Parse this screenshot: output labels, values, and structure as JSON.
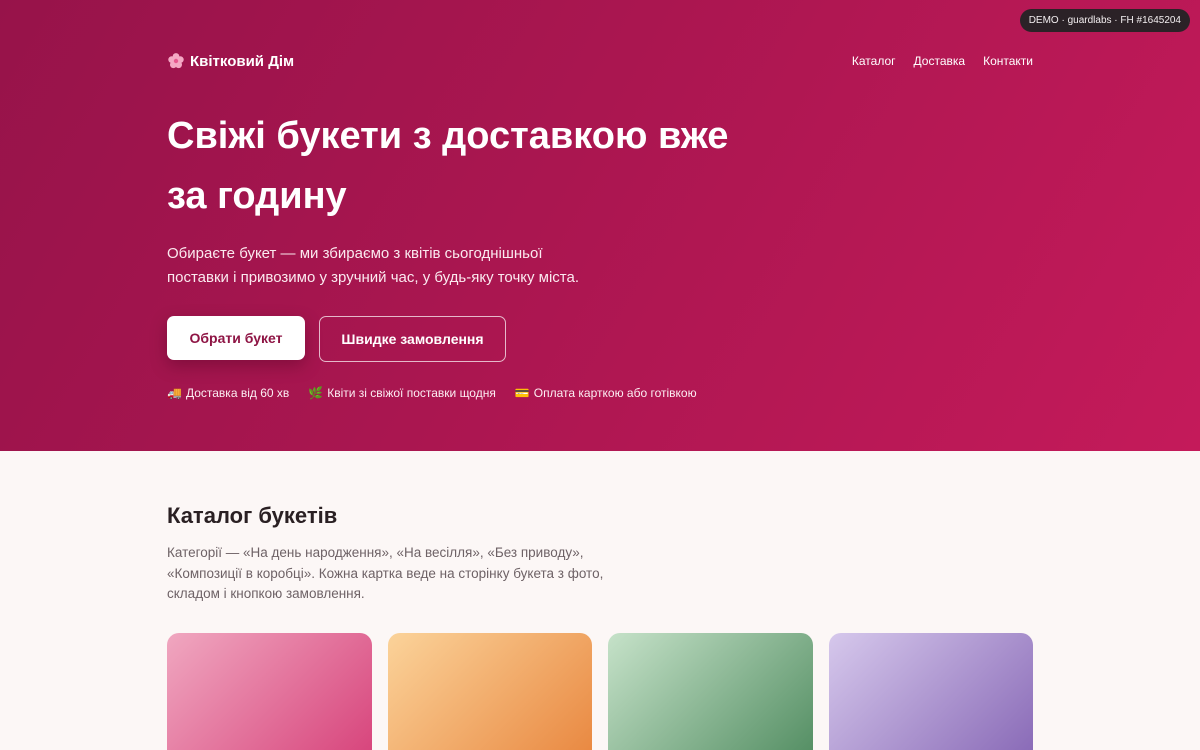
{
  "demo_badge": "DEMO · guardlabs · FH #1645204",
  "brand": {
    "name": "Квітковий Дім",
    "icon": "flower-icon"
  },
  "nav": [
    {
      "label": "Каталог"
    },
    {
      "label": "Доставка"
    },
    {
      "label": "Контакти"
    }
  ],
  "hero": {
    "title": "Свіжі букети з доставкою вже за годину",
    "lead": "Обираєте букет — ми збираємо з квітів сьогоднішньої поставки і привозимо у зручний час, у будь-яку точку міста.",
    "primary_cta": "Обрати букет",
    "secondary_cta": "Швидке замовлення",
    "features": [
      {
        "icon": "🚚",
        "icon_name": "truck-icon",
        "label": "Доставка від 60 хв"
      },
      {
        "icon": "🌿",
        "icon_name": "leaf-icon",
        "label": "Квіти зі свіжої поставки щодня"
      },
      {
        "icon": "💳",
        "icon_name": "card-icon",
        "label": "Оплата карткою або готівкою"
      }
    ]
  },
  "catalog": {
    "title": "Каталог букетів",
    "description": "Категорії — «На день народження», «На весілля», «Без приводу», «Композиції в коробці». Кожна картка веде на сторінку букета з фото, складом і кнопкою замовлення."
  },
  "colors": {
    "hero_start": "#97134a",
    "hero_end": "#c41a5a",
    "accent_text": "#8e1444",
    "page_bg": "#fcf7f6"
  }
}
